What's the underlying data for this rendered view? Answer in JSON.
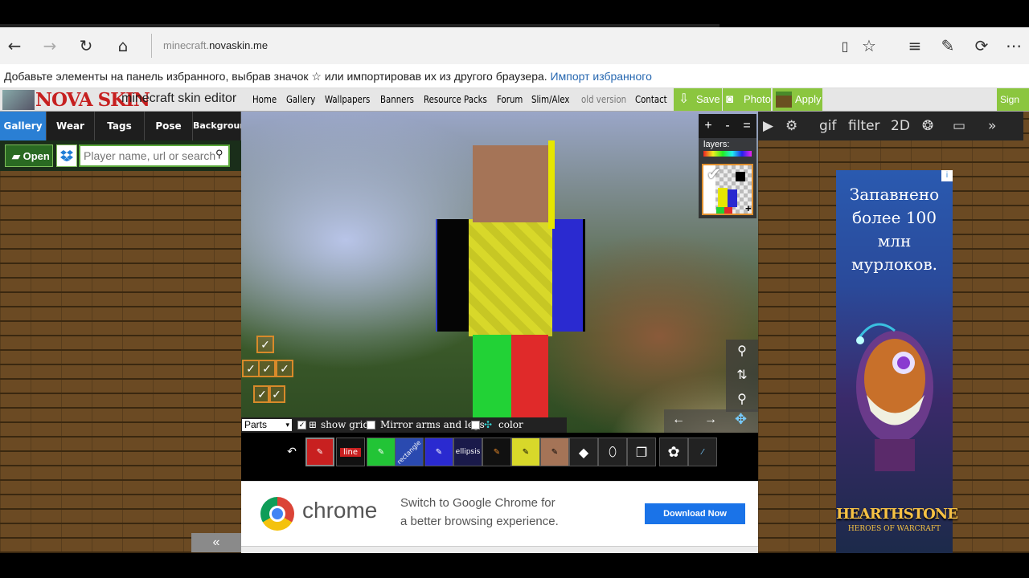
{
  "browser": {
    "url_host": "minecraft.",
    "url_domain": "novaskin.me",
    "favbar_text": "Добавьте элементы на панель избранного, выбрав значок ☆ или импортировав их из другого браузера.",
    "favbar_link": "Импорт избранного"
  },
  "site": {
    "logo": "NOVA SKIN",
    "logo_sub": "minecraft skin editor",
    "menu": [
      "Home",
      "Gallery",
      "Wallpapers",
      "Banners",
      "Resource Packs",
      "Forum",
      "Slim/Alex",
      "old version",
      "Contact"
    ],
    "save_label": "Save",
    "photo_label": "Photo",
    "apply_label": "Apply",
    "signin_label": "Sign in"
  },
  "left": {
    "tabs": [
      "Gallery",
      "Wear",
      "Tags",
      "Pose",
      "Background"
    ],
    "open_label": "Open",
    "player_placeholder": "Player name, url or search",
    "collapse": "«"
  },
  "editor": {
    "layers_label": "layers:",
    "view_buttons": [
      "+",
      "-",
      "="
    ],
    "parts_select": "Parts",
    "show_grid": "show grid",
    "mirror": "Mirror arms and legs",
    "color_variation": "color variation",
    "tool_line": "line",
    "tool_rectangle": "rectangle",
    "tool_ellipsis": "ellipsis"
  },
  "right": {
    "tools": [
      "gif",
      "filter",
      "2D"
    ]
  },
  "ad": {
    "text_1": "Запавнено",
    "text_2": "более 100",
    "text_3": "млн",
    "text_4": "мурлоков.",
    "brand": "HEARTHSTONE",
    "brand_sub": "HEROES OF WARCRAFT"
  },
  "chrome_ad": {
    "brand": "chrome",
    "line1": "Switch to Google Chrome for",
    "line2": "a better browsing experience.",
    "button": "Download Now"
  },
  "colors": {
    "accent_green": "#8bc63f",
    "link_blue": "#2667b0",
    "logo_red": "#c62020"
  }
}
